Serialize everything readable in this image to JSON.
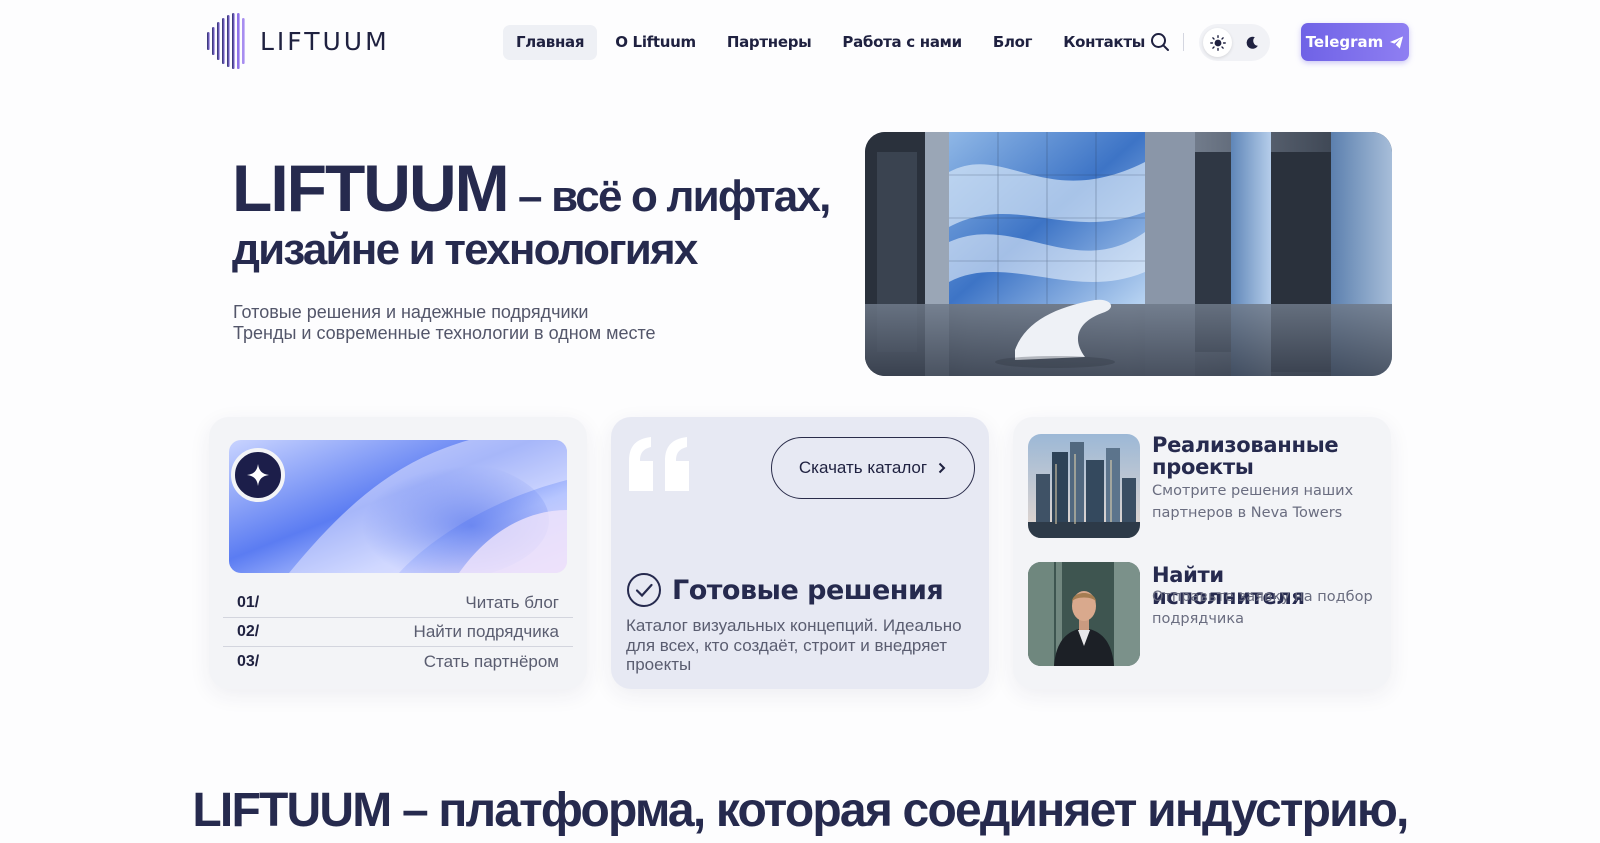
{
  "header": {
    "logo_text": "LIFTUUM",
    "nav": [
      {
        "label": "Главная",
        "active": true
      },
      {
        "label": "О Liftuum",
        "active": false
      },
      {
        "label": "Партнеры",
        "active": false
      },
      {
        "label": "Работа с нами",
        "active": false
      },
      {
        "label": "Блог",
        "active": false
      },
      {
        "label": "Контакты",
        "active": false
      }
    ],
    "theme": "light",
    "telegram_label": "Telegram"
  },
  "hero": {
    "brand": "LIFTUUM",
    "title_rest": " – всё о лифтах,",
    "title_line2": "дизайне и технологиях",
    "subtitle_line1": "Готовые решения и надежные подрядчики",
    "subtitle_line2": "Тренды и современные технологии в одном месте"
  },
  "card_blog": {
    "items": [
      {
        "num": "01/",
        "label": "Читать блог"
      },
      {
        "num": "02/",
        "label": "Найти подрядчика"
      },
      {
        "num": "03/",
        "label": "Стать партнёром"
      }
    ]
  },
  "card_catalog": {
    "download_label": "Скачать каталог",
    "title": "Готовые решения",
    "description": "Каталог визуальных концепций. Идеально для всех, кто создаёт, строит и внедряет проекты"
  },
  "card_projects": {
    "projects_title": "Реализованные проекты",
    "projects_desc": "Смотрите решения наших партнеров в Neva Towers",
    "contractor_title": "Найти исполнителя",
    "contractor_desc": "Отправьте заявку на подбор подрядчика"
  },
  "bottom": {
    "title": "LIFTUUM – платформа, которая соединяет индустрию,"
  },
  "colors": {
    "primary_text": "#262a4e",
    "accent": "#7a6cec",
    "card_bg": "#f3f4f7",
    "catalog_card_bg": "#e7e9f3"
  }
}
